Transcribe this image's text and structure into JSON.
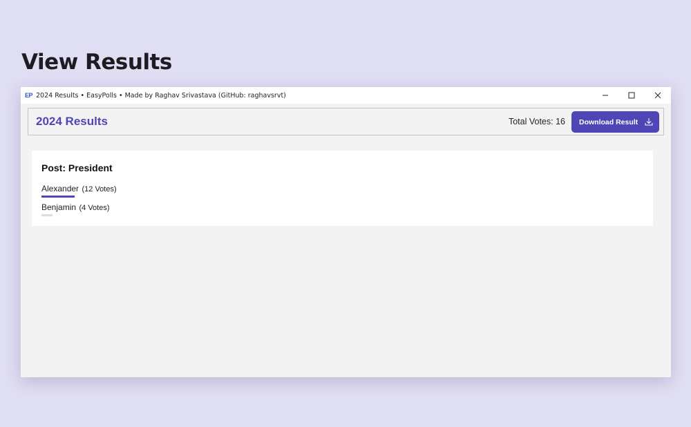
{
  "page": {
    "heading": "View Results"
  },
  "window": {
    "logo": "EP",
    "title": "2024 Results  •  EasyPolls  •  Made by Raghav Srivastava (GitHub: raghavsrvt)",
    "controls": [
      "minimize-icon",
      "maximize-icon",
      "close-icon"
    ]
  },
  "header": {
    "title": "2024 Results",
    "total_votes": "Total Votes: 16",
    "download_label": "Download Result",
    "download_icon": "download-icon"
  },
  "results": {
    "post_title": "Post: President",
    "total": 16,
    "candidates": [
      {
        "name": "Alexander",
        "votes_label": "(12 Votes)",
        "votes": 12,
        "bar_color": "#4e46b6"
      },
      {
        "name": "Benjamin",
        "votes_label": "(4 Votes)",
        "votes": 4,
        "bar_color": "#dcdcdc"
      }
    ]
  },
  "colors": {
    "accent": "#4e46b6",
    "background": "#e0def2",
    "window_bg": "#f3f3f3"
  }
}
